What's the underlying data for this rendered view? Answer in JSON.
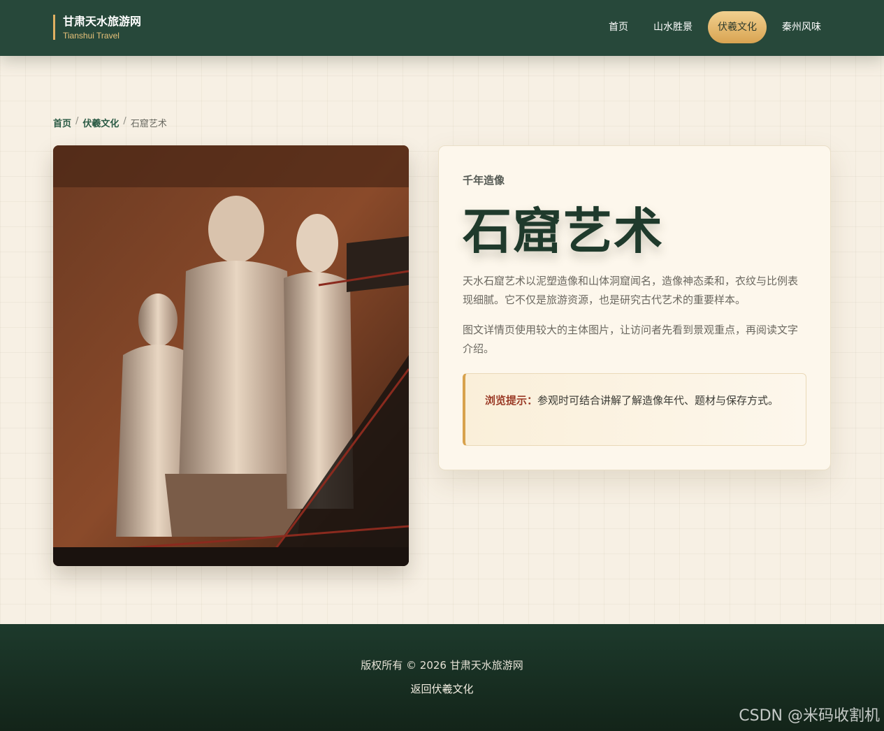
{
  "header": {
    "brand_title": "甘肃天水旅游网",
    "brand_subtitle": "Tianshui Travel",
    "nav": [
      {
        "label": "首页"
      },
      {
        "label": "山水胜景"
      },
      {
        "label": "伏羲文化",
        "active": true
      },
      {
        "label": "秦州风味"
      }
    ]
  },
  "breadcrumb": {
    "home": "首页",
    "sep1": "/",
    "section": "伏羲文化",
    "sep2": "/",
    "current": "石窟艺术"
  },
  "article": {
    "eyebrow": "千年造像",
    "title": "石窟艺术",
    "paragraph1": "天水石窟艺术以泥塑造像和山体洞窟闻名，造像神态柔和，衣纹与比例表现细腻。它不仅是旅游资源，也是研究古代艺术的重要样本。",
    "paragraph2": "图文详情页使用较大的主体图片，让访问者先看到景观重点，再阅读文字介绍。",
    "tip_label": "浏览提示：",
    "tip_text": "参观时可结合讲解了解造像年代、题材与保存方式。"
  },
  "footer": {
    "copyright": "版权所有 © 2026 甘肃天水旅游网",
    "back_link": "返回伏羲文化",
    "watermark": "CSDN @米码收割机"
  },
  "colors": {
    "header_bg": "#27483a",
    "accent_gold": "#e0b062",
    "title_green": "#1f3a2c",
    "tip_label": "#9a3a26"
  }
}
